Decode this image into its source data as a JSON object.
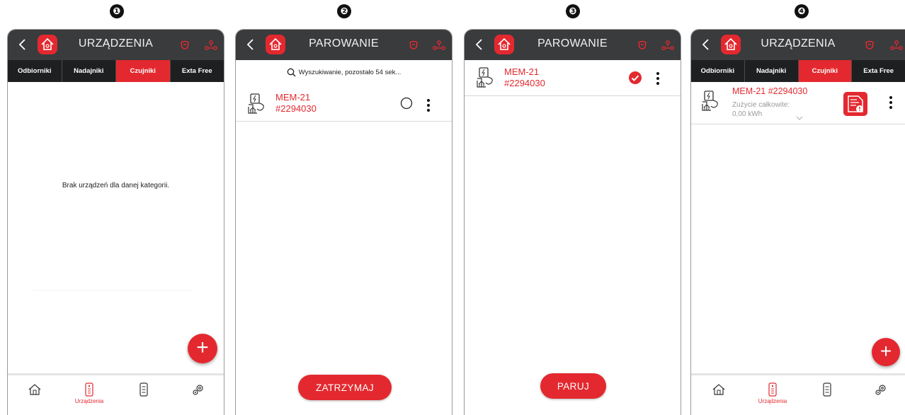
{
  "steps": [
    "❶",
    "❷",
    "❸",
    "❹"
  ],
  "colors": {
    "accent": "#e3292f",
    "topbar": "#3a3b3d",
    "tabbar": "#1e1f21"
  },
  "screen1": {
    "title": "URZĄDZENIA",
    "tabs": [
      "Odbiorniki",
      "Nadajniki",
      "Czujniki",
      "Exta Free"
    ],
    "active_tab": "Czujniki",
    "empty_message": "Brak urządzeń dla danej kategorii.",
    "fab": "+",
    "bottom_nav": [
      {
        "icon": "house-icon",
        "label": ""
      },
      {
        "icon": "remote-icon",
        "label": "Urządzenia"
      },
      {
        "icon": "panel-icon",
        "label": ""
      },
      {
        "icon": "gears-icon",
        "label": ""
      }
    ]
  },
  "screen2": {
    "title": "PAROWANIE",
    "search_status": "Wyszukiwanie, pozostało 54 sek...",
    "device": {
      "name_line1": "MEM-21",
      "name_line2": "#2294030"
    },
    "button": "ZATRZYMAJ"
  },
  "screen3": {
    "title": "PAROWANIE",
    "device": {
      "name_line1": "MEM-21",
      "name_line2": "#2294030"
    },
    "button": "PARUJ"
  },
  "screen4": {
    "title": "URZĄDZENIA",
    "tabs": [
      "Odbiorniki",
      "Nadajniki",
      "Czujniki",
      "Exta Free"
    ],
    "active_tab": "Czujniki",
    "device": {
      "name": "MEM-21 #2294030",
      "consumption_label": "Zużycie całkowite:",
      "consumption_value": "0,00 kWh"
    },
    "fab": "+",
    "bottom_label": "Urządzenia"
  }
}
